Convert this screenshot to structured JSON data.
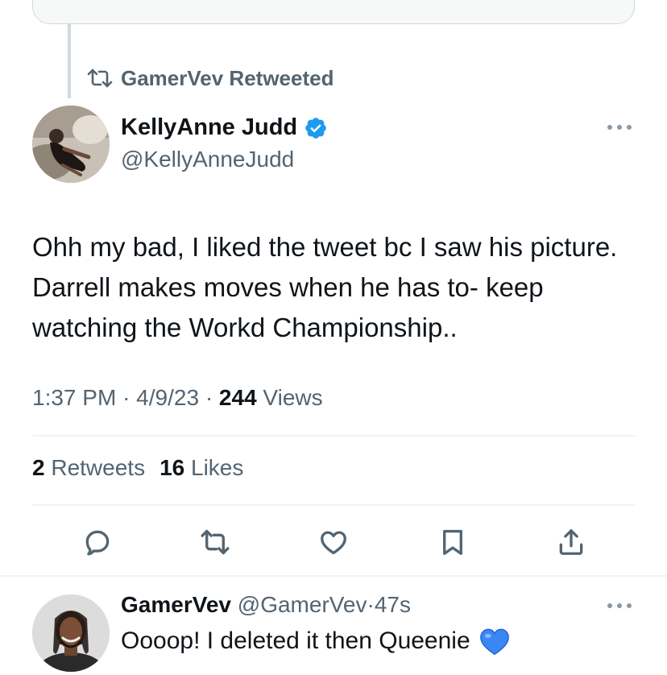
{
  "retweet": {
    "label": "GamerVev Retweeted"
  },
  "tweet": {
    "author_name": "KellyAnne Judd",
    "author_handle": "@KellyAnneJudd",
    "text": "Ohh my bad, I liked the tweet bc I saw his picture. Darrell makes moves when he has to- keep watching the Workd Championship..",
    "time": "1:37 PM",
    "date": "4/9/23",
    "views_count": "244",
    "views_label": "Views",
    "retweets_count": "2",
    "retweets_label": "Retweets",
    "likes_count": "16",
    "likes_label": "Likes"
  },
  "actions": [
    "reply-icon",
    "retweet-icon",
    "like-icon",
    "bookmark-icon",
    "share-icon"
  ],
  "reply": {
    "author_name": "GamerVev",
    "author_handle": "@GamerVev",
    "separator": "·",
    "time": "47s",
    "text": "Oooop! I deleted it then Queenie"
  },
  "colors": {
    "text_primary": "#0f1419",
    "text_secondary": "#536471",
    "verified_blue": "#1d9bf0",
    "divider": "#eff3f4"
  }
}
